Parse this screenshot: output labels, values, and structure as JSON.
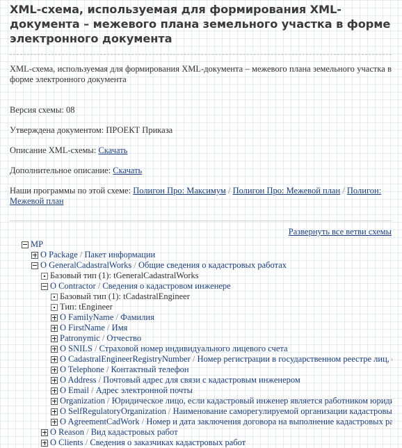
{
  "page": {
    "title": "XML-схема, используемая для формирования XML-документа – межевого плана земельного участка в форме электронного документа",
    "description": "XML-схема, используемая для формирования XML-документа – межевого плана земельного участка в форме электронного документа",
    "version_label": "Версия схемы: 08",
    "approved_label": "Утверждена документом: ПРОЕКТ Приказа",
    "schema_description_label": "Описание XML-схемы: ",
    "schema_description_link": "Скачать",
    "additional_description_label": "Дополнительное описание: ",
    "additional_description_link": "Скачать",
    "programs_label": "Наши программы по этой схеме: ",
    "programs": [
      "Полигон Про: Максимум",
      "Полигон Про: Межевой план",
      "Полигон: Межевой план"
    ],
    "programs_separator": " / ",
    "expand_all_link": "Развернуть все ветви схемы"
  },
  "tree": [
    {
      "level": 0,
      "toggle": "minus",
      "name": "MP",
      "desc": ""
    },
    {
      "level": 1,
      "toggle": "plus",
      "name": "O Package",
      "desc": "Пакет информации"
    },
    {
      "level": 1,
      "toggle": "minus",
      "name": "O GeneralCadastralWorks",
      "desc": "Общие сведения о кадастровых работах"
    },
    {
      "level": 2,
      "toggle": "dot",
      "name": "Базовый тип (1): tGeneralCadastralWorks",
      "desc": ""
    },
    {
      "level": 2,
      "toggle": "minus",
      "name": "O Contractor",
      "desc": "Сведения о кадастровом инженере"
    },
    {
      "level": 3,
      "toggle": "dot",
      "name": "Базовый тип (1): tCadastralEngineer",
      "desc": ""
    },
    {
      "level": 3,
      "toggle": "dot",
      "name": "Тип: tEngineer",
      "desc": ""
    },
    {
      "level": 3,
      "toggle": "plus",
      "name": "O FamilyName",
      "desc": "Фамилия"
    },
    {
      "level": 3,
      "toggle": "plus",
      "name": "O FirstName",
      "desc": "Имя"
    },
    {
      "level": 3,
      "toggle": "plus",
      "name": "Patronymic",
      "desc": "Отчество"
    },
    {
      "level": 3,
      "toggle": "plus",
      "name": "O SNILS",
      "desc": "Страховой номер индивидуального лицевого счета"
    },
    {
      "level": 3,
      "toggle": "plus",
      "name": "O CadastralEngineerRegistryNumber",
      "desc": "Номер регистрации в государственном реестре лиц, осуществляющих кадастровую деятельность"
    },
    {
      "level": 3,
      "toggle": "plus",
      "name": "O Telephone",
      "desc": "Контактный телефон"
    },
    {
      "level": 3,
      "toggle": "plus",
      "name": "O Address",
      "desc": "Почтовый адрес для связи с кадастровым инженером"
    },
    {
      "level": 3,
      "toggle": "plus",
      "name": "O Email",
      "desc": "Адрес электронной почты"
    },
    {
      "level": 3,
      "toggle": "plus",
      "name": "Organization",
      "desc": "Юридическое лицо, если кадастровый инженер является работником юридического лица"
    },
    {
      "level": 3,
      "toggle": "plus",
      "name": "O SelfRegulatoryOrganization",
      "desc": "Наименование саморегулируемой организации кадастровых инженеров"
    },
    {
      "level": 3,
      "toggle": "plus",
      "name": "O AgreementCadWork",
      "desc": "Номер и дата заключения договора на выполнение кадастровых работ"
    },
    {
      "level": 2,
      "toggle": "plus",
      "name": "O Reason",
      "desc": "Вид кадастровых работ"
    },
    {
      "level": 2,
      "toggle": "plus",
      "name": "O Clients",
      "desc": "Сведения о заказчиках кадастровых работ"
    }
  ],
  "tree_separator": " / ",
  "colors": {
    "link": "#1a3e7a",
    "title": "#3b3b3b",
    "text": "#333333"
  }
}
